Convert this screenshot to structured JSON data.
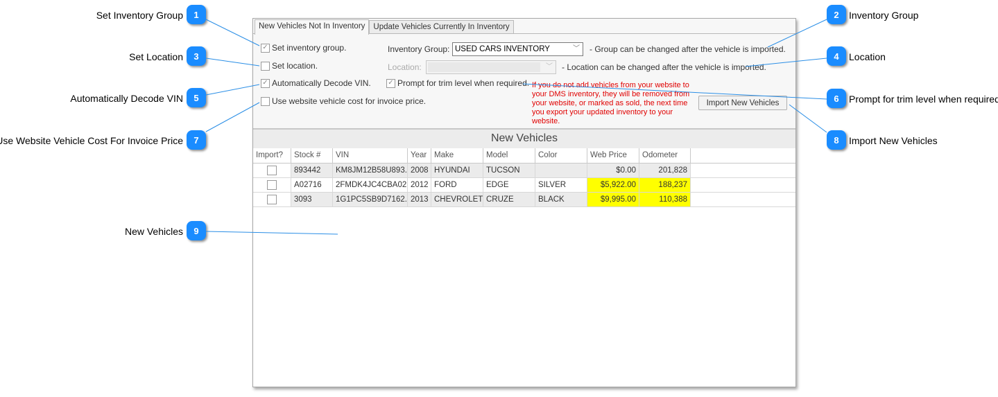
{
  "callouts": [
    {
      "number": "1",
      "label": "Set Inventory Group"
    },
    {
      "number": "2",
      "label": "Inventory Group"
    },
    {
      "number": "3",
      "label": "Set Location"
    },
    {
      "number": "4",
      "label": "Location"
    },
    {
      "number": "5",
      "label": "Automatically Decode VIN"
    },
    {
      "number": "6",
      "label": "Prompt for trim level when required"
    },
    {
      "number": "7",
      "label": "Use Website Vehicle Cost For Invoice Price"
    },
    {
      "number": "8",
      "label": "Import New Vehicles"
    },
    {
      "number": "9",
      "label": "New Vehicles"
    }
  ],
  "tabs": [
    {
      "label": "New Vehicles Not In Inventory",
      "active": true
    },
    {
      "label": "Update Vehicles Currently In Inventory",
      "active": false
    }
  ],
  "options": {
    "set_inventory_group": {
      "label": "Set inventory group.",
      "checked": true
    },
    "set_location": {
      "label": "Set location.",
      "checked": false
    },
    "decode_vin": {
      "label": "Automatically Decode VIN.",
      "checked": true
    },
    "prompt_trim": {
      "label": "Prompt for trim level when required.",
      "checked": true
    },
    "use_cost": {
      "label": "Use website vehicle cost for invoice price.",
      "checked": false
    }
  },
  "inventory_group": {
    "label": "Inventory Group:",
    "value": "USED CARS INVENTORY",
    "note": "- Group can be changed after the vehicle is imported."
  },
  "location": {
    "label": "Location:",
    "value": "",
    "note": "- Location can be changed after the vehicle is imported."
  },
  "warning": "If you do not add vehicles from your website to your DMS inventory, they will be removed from your website, or marked as sold, the next time you export your updated inventory to your website.",
  "import_button": "Import New Vehicles",
  "grid": {
    "title": "New Vehicles",
    "columns": [
      "Import?",
      "Stock #",
      "VIN",
      "Year",
      "Make",
      "Model",
      "Color",
      "Web Price",
      "Odometer"
    ],
    "rows": [
      {
        "import": false,
        "stock": "893442",
        "vin": "KM8JM12B58U893...",
        "year": "2008",
        "make": "HYUNDAI",
        "model": "TUCSON",
        "color": "",
        "web_price": "$0.00",
        "odometer": "201,828",
        "highlight": false
      },
      {
        "import": false,
        "stock": "A02716",
        "vin": "2FMDK4JC4CBA02...",
        "year": "2012",
        "make": "FORD",
        "model": "EDGE",
        "color": "SILVER",
        "web_price": "$5,922.00",
        "odometer": "188,237",
        "highlight": true
      },
      {
        "import": false,
        "stock": "3093",
        "vin": "1G1PC5SB9D7162...",
        "year": "2013",
        "make": "CHEVROLET",
        "model": "CRUZE",
        "color": "BLACK",
        "web_price": "$9,995.00",
        "odometer": "110,388",
        "highlight": true
      }
    ]
  },
  "colors": {
    "callout_badge": "#1a8cff",
    "warning_text": "#e00000",
    "highlight": "#ffff00"
  }
}
